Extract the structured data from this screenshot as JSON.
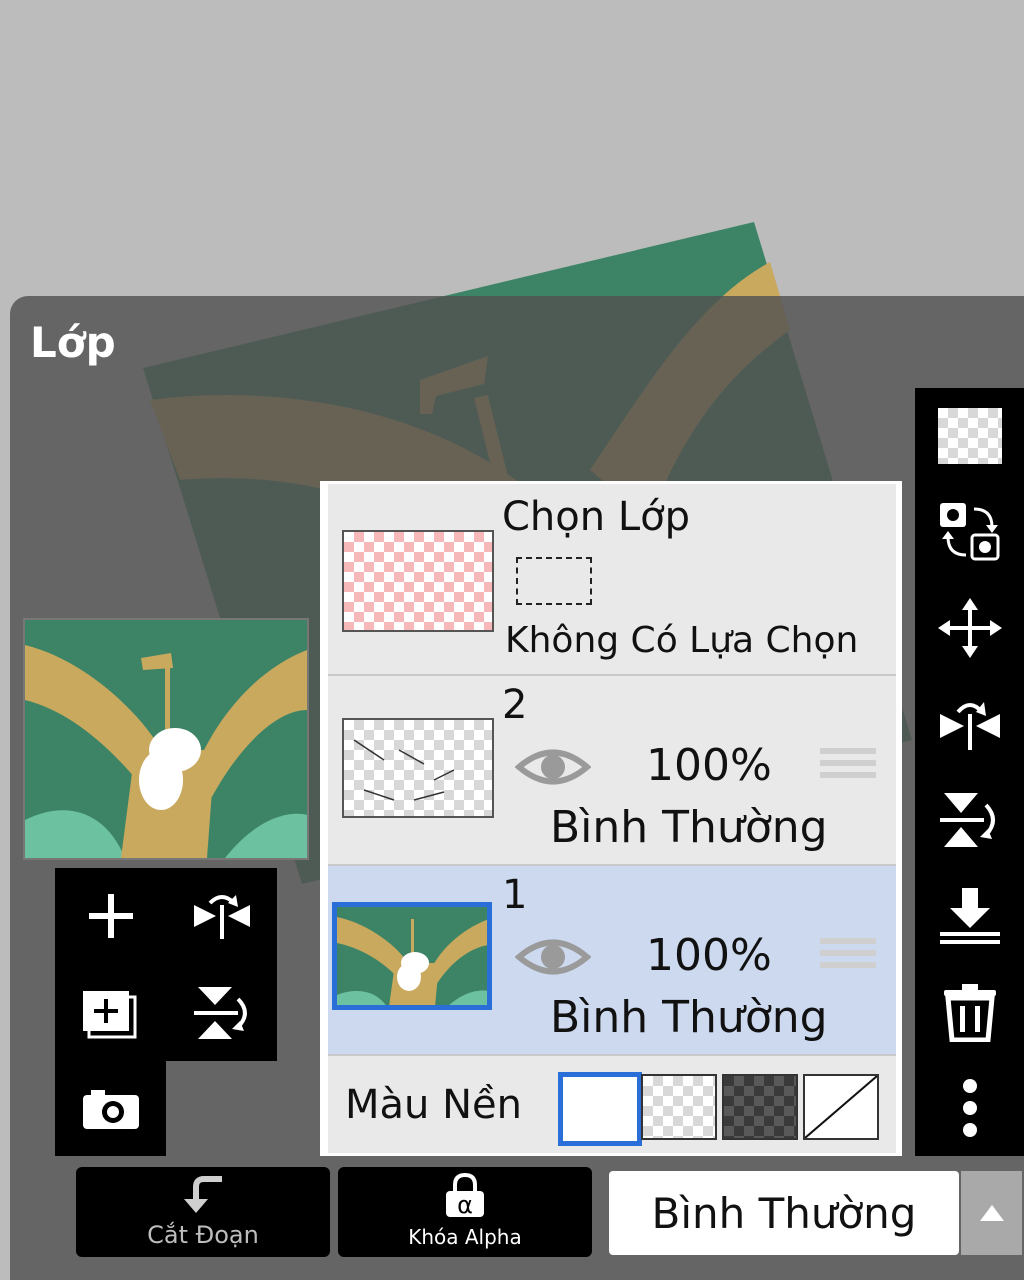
{
  "panel": {
    "title": "Lớp"
  },
  "selection_row": {
    "title": "Chọn Lớp",
    "status": "Không Có Lựa Chọn"
  },
  "layers": [
    {
      "name": "2",
      "opacity": "100%",
      "blend": "Bình Thường",
      "selected": false
    },
    {
      "name": "1",
      "opacity": "100%",
      "blend": "Bình Thường",
      "selected": true
    }
  ],
  "background": {
    "label": "Màu Nền",
    "options": [
      "white",
      "light-checker",
      "dark-checker",
      "none"
    ],
    "selected": "white"
  },
  "bottom_bar": {
    "clip_label": "Cắt Đoạn",
    "alpha_lock_label": "Khóa Alpha",
    "blend_mode": "Bình Thường"
  },
  "colors": {
    "panel_bg": "#525252",
    "selected_row": "#cdd9ee",
    "accent": "#2a6fd8",
    "art_green": "#3d8466",
    "art_tan": "#c9a95e"
  }
}
